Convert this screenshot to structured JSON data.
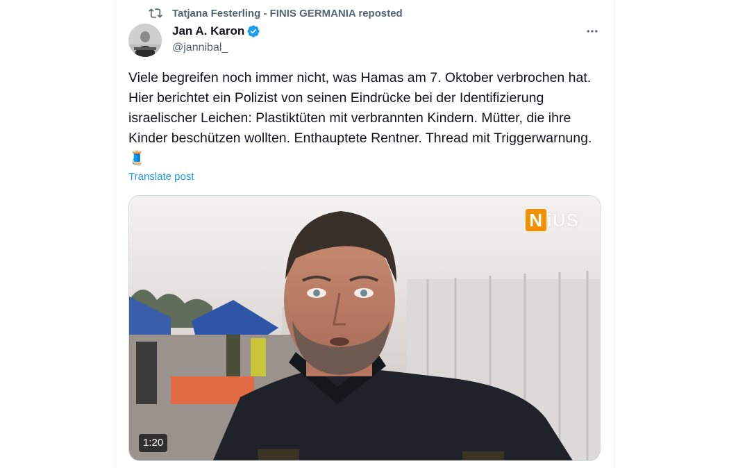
{
  "repost": {
    "text": "Tatjana Festerling - FINIS GERMANIA reposted",
    "icon": "repost-icon"
  },
  "author": {
    "name": "Jan A. Karon",
    "handle": "@jannibal_",
    "verified": true,
    "verified_color": "#1d9bf0"
  },
  "post": {
    "text": "Viele begreifen noch immer nicht, was Hamas am 7. Oktober verbrochen hat. Hier berichtet ein Polizist von seinen Eindrücke bei der Identifizierung israelischer Leichen: Plastiktüten mit verbrannten Kindern. Mütter, die ihre Kinder beschützen wollten. Enthauptete Rentner. Thread mit Triggerwarnung. 🧵",
    "translate_label": "Translate post"
  },
  "media": {
    "duration": "1:20",
    "watermark_first": "N",
    "watermark_rest": "iUS",
    "watermark_color": "#f39000"
  },
  "colors": {
    "secondary_text": "#536471",
    "link": "#1d9bf0",
    "border": "#eff3f4"
  }
}
